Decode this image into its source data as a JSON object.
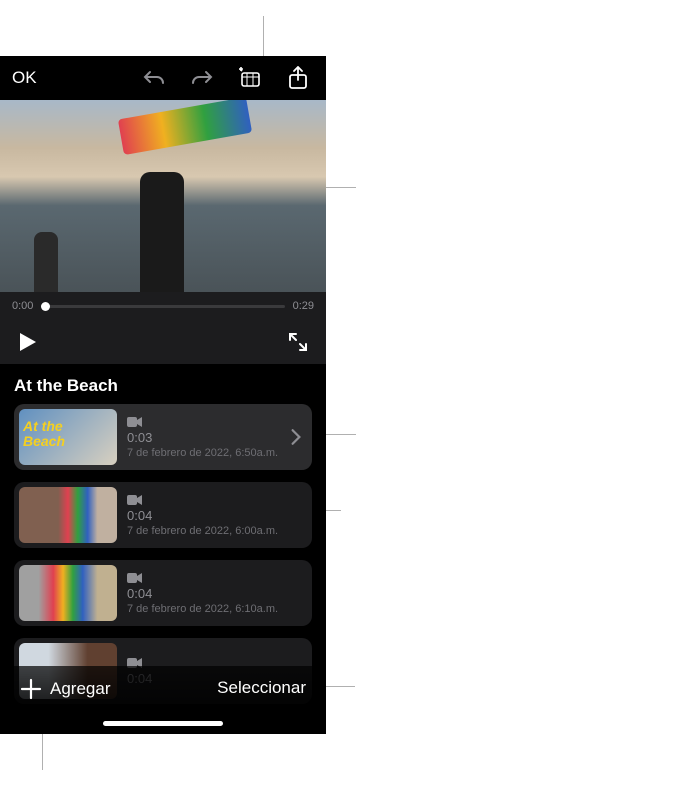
{
  "toolbar": {
    "ok_label": "OK"
  },
  "playback": {
    "current_time": "0:00",
    "total_time": "0:29"
  },
  "project": {
    "title": "At the Beach"
  },
  "clips": [
    {
      "duration": "0:03",
      "date": "7 de febrero de 2022, 6:50a.m.",
      "selected": true,
      "thumb": "a",
      "has_chevron": true
    },
    {
      "duration": "0:04",
      "date": "7 de febrero de 2022, 6:00a.m.",
      "selected": false,
      "thumb": "b",
      "has_chevron": false
    },
    {
      "duration": "0:04",
      "date": "7 de febrero de 2022, 6:10a.m.",
      "selected": false,
      "thumb": "c",
      "has_chevron": false
    },
    {
      "duration": "0:04",
      "date": "",
      "selected": false,
      "thumb": "d",
      "has_chevron": false
    }
  ],
  "bottom": {
    "add_label": "Agregar",
    "select_label": "Seleccionar"
  }
}
